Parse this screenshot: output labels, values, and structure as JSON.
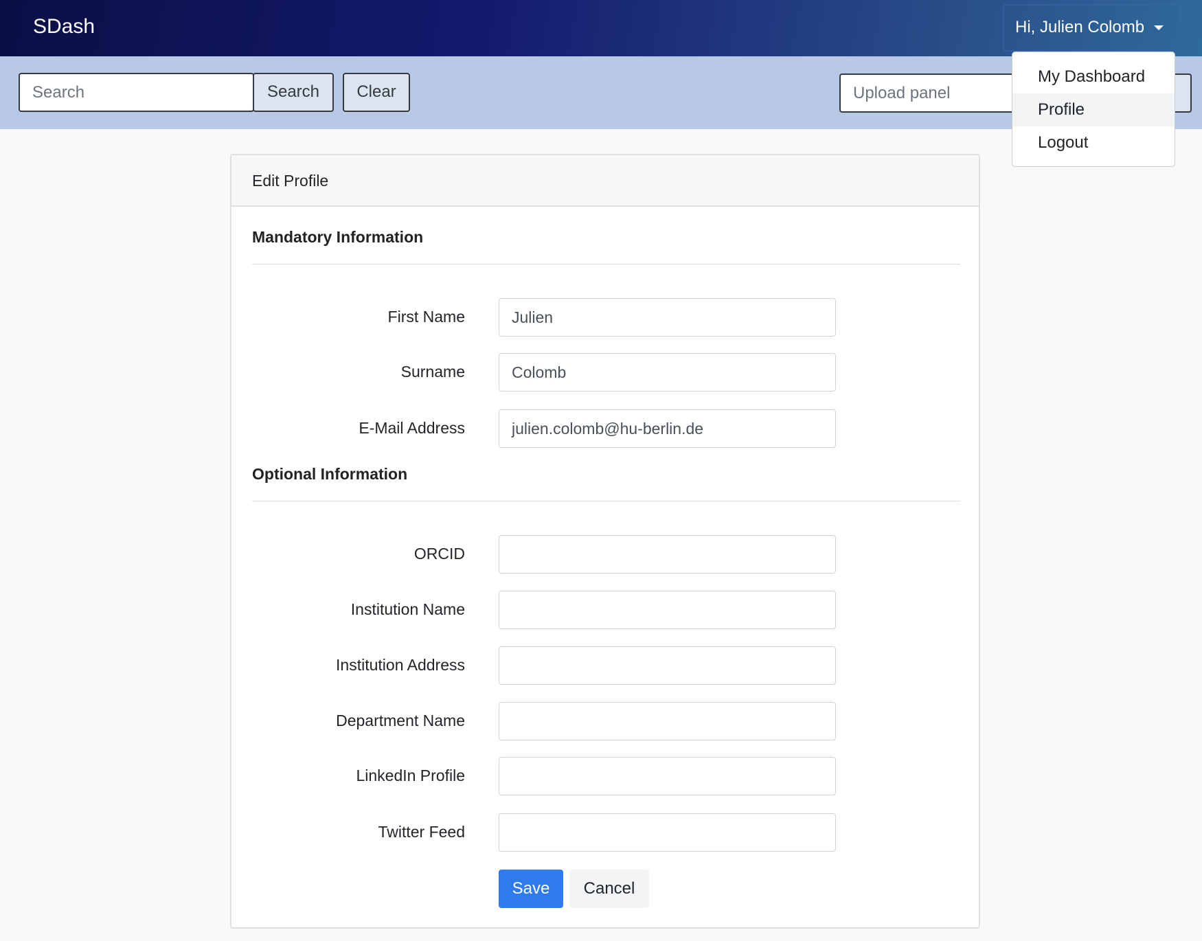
{
  "navbar": {
    "brand": "SDash",
    "user_menu_label": "Hi, Julien Colomb"
  },
  "user_menu": {
    "items": [
      {
        "label": "My Dashboard"
      },
      {
        "label": "Profile"
      },
      {
        "label": "Logout"
      }
    ]
  },
  "toolbar": {
    "search_placeholder": "Search",
    "search_label": "Search",
    "clear_label": "Clear",
    "upload_placeholder": "Upload panel"
  },
  "card": {
    "title": "Edit Profile",
    "mandatory_heading": "Mandatory Information",
    "optional_heading": "Optional Information",
    "fields": [
      {
        "label": "First Name",
        "value": "Julien"
      },
      {
        "label": "Surname",
        "value": "Colomb"
      },
      {
        "label": "E-Mail Address",
        "value": "julien.colomb@hu-berlin.de"
      },
      {
        "label": "ORCID",
        "value": ""
      },
      {
        "label": "Institution Name",
        "value": ""
      },
      {
        "label": "Institution Address",
        "value": ""
      },
      {
        "label": "Department Name",
        "value": ""
      },
      {
        "label": "LinkedIn Profile",
        "value": ""
      },
      {
        "label": "Twitter Feed",
        "value": ""
      }
    ],
    "save_label": "Save",
    "cancel_label": "Cancel"
  }
}
